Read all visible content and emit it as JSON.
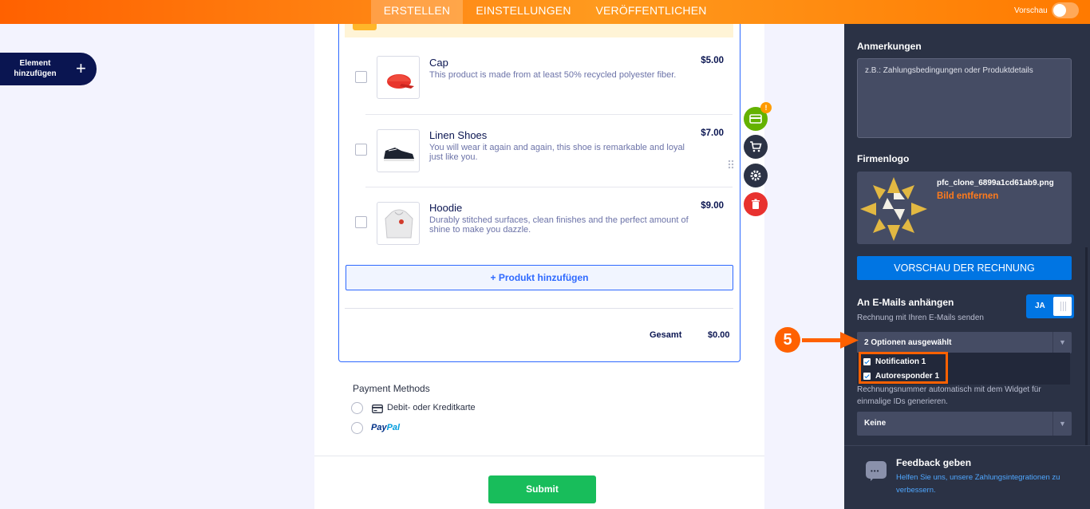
{
  "topbar": {
    "tabs": [
      {
        "label": "ERSTELLEN",
        "active": true
      },
      {
        "label": "EINSTELLUNGEN",
        "active": false
      },
      {
        "label": "VERÖFFENTLICHEN",
        "active": false
      }
    ],
    "preview_label": "Vorschau",
    "preview_on": false
  },
  "add_element": {
    "label": "Element hinzufügen",
    "icon": "plus-icon"
  },
  "products": [
    {
      "name": "Cap",
      "description": "This product is made from at least 50% recycled polyester fiber.",
      "price": "$5.00",
      "checked": false
    },
    {
      "name": "Linen Shoes",
      "description": "You will wear it again and again, this shoe is remarkable and loyal just like you.",
      "price": "$7.00",
      "checked": false
    },
    {
      "name": "Hoodie",
      "description": "Durably stitched surfaces, clean finishes and the perfect amount of shine to make you dazzle.",
      "price": "$9.00",
      "checked": false
    }
  ],
  "add_product_label": "+ Produkt hinzufügen",
  "total": {
    "label": "Gesamt",
    "value": "$0.00"
  },
  "payment": {
    "title": "Payment Methods",
    "options": [
      {
        "label": "Debit- oder Kreditkarte",
        "icon": "credit-card-icon"
      },
      {
        "label": "PayPal",
        "icon": "paypal-logo"
      }
    ]
  },
  "submit_label": "Submit",
  "tools": {
    "badge": "!"
  },
  "panel": {
    "notes_title": "Anmerkungen",
    "notes_placeholder": "z.B.: Zahlungsbedingungen oder Produktdetails",
    "logo_title": "Firmenlogo",
    "logo_file": "pfc_clone_6899a1cd61ab9.png",
    "logo_remove": "Bild entfernen",
    "preview_invoice": "VORSCHAU DER RECHNUNG",
    "attach_title": "An E-Mails anhängen",
    "attach_sub": "Rechnung mit Ihren E-Mails senden",
    "attach_toggle": "JA",
    "select_value": "2 Optionen ausgewählt",
    "options": [
      {
        "label": "Notification 1",
        "checked": true
      },
      {
        "label": "Autoresponder 1",
        "checked": true
      }
    ],
    "hidden_text": "Rechnungsnummer automatisch mit dem Widget für einmalige IDs generieren.",
    "id_select_value": "Keine",
    "feedback_title": "Feedback geben",
    "feedback_link": "Helfen Sie uns, unsere Zahlungsintegrationen zu verbessern."
  },
  "annotation": {
    "step": "5"
  },
  "colors": {
    "accent": "#ff6100",
    "primary": "#2e69ff",
    "panel": "#2b3245",
    "submit": "#18bd5b"
  }
}
